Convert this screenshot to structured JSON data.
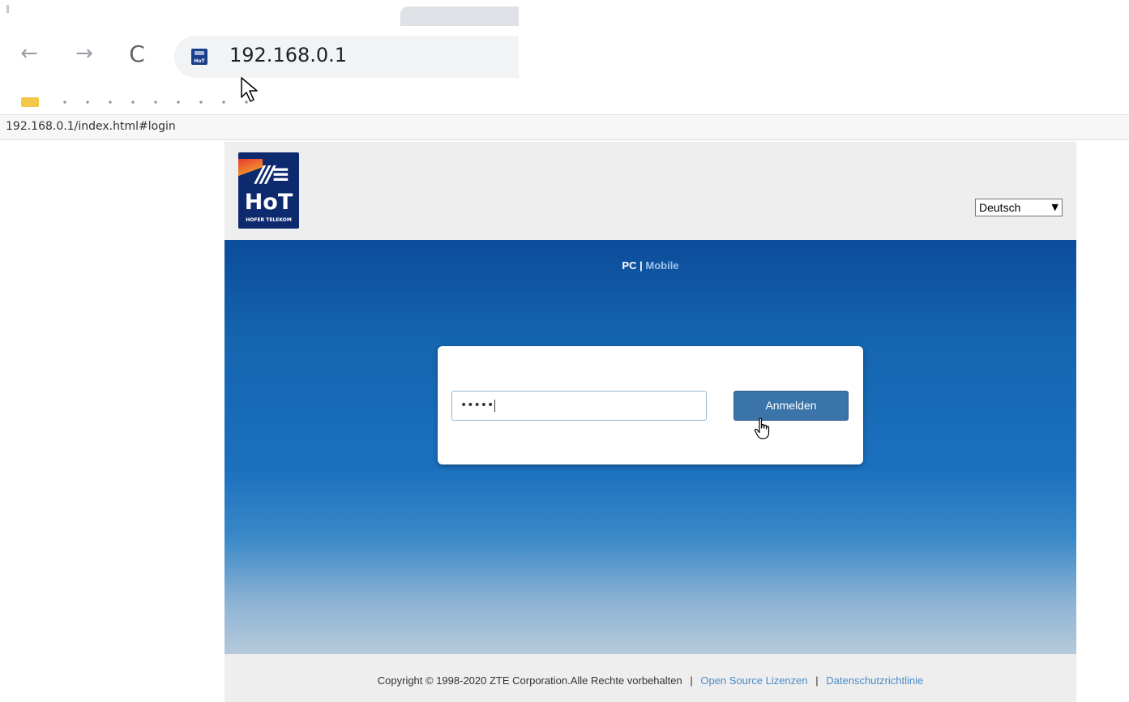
{
  "browser": {
    "url": "192.168.0.1",
    "status_url": "192.168.0.1/index.html#login",
    "back_glyph": "←",
    "forward_glyph": "→",
    "reload_glyph": "C"
  },
  "header": {
    "logo_text": "HoT",
    "logo_subtext": "HOFER TELEKOM",
    "logo_marks": "///≡",
    "language": {
      "selected": "Deutsch",
      "chevron": "⌄"
    }
  },
  "mode_switch": {
    "pc": "PC",
    "separator": "|",
    "mobile": "Mobile"
  },
  "login": {
    "password_value": "•••••",
    "button_label": "Anmelden"
  },
  "footer": {
    "copyright": "Copyright © 1998-2020 ZTE Corporation.Alle Rechte vorbehalten",
    "separator": "|",
    "open_source": "Open Source Lizenzen",
    "privacy": "Datenschutzrichtlinie"
  },
  "colors": {
    "brand_blue": "#0b4d9a",
    "button": "#3a74a8",
    "link": "#4a8ac8"
  }
}
